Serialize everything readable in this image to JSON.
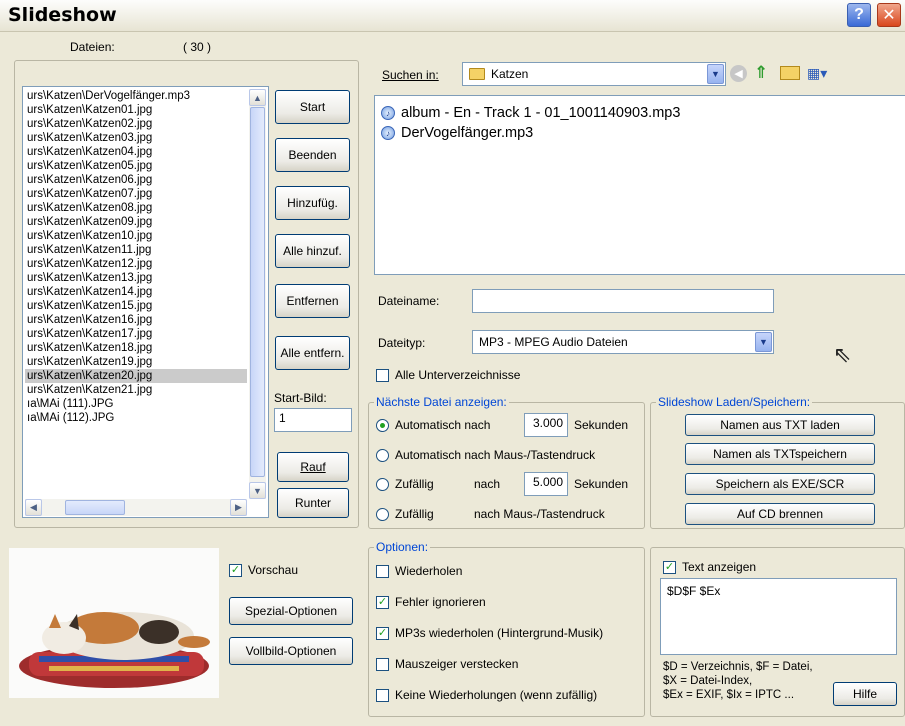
{
  "window": {
    "title": "Slideshow",
    "help_icon": "?",
    "close_icon": "✕"
  },
  "files": {
    "label": "Dateien:",
    "count": "( 30 )",
    "items": [
      "urs\\Katzen\\DerVogelfänger.mp3",
      "urs\\Katzen\\Katzen01.jpg",
      "urs\\Katzen\\Katzen02.jpg",
      "urs\\Katzen\\Katzen03.jpg",
      "urs\\Katzen\\Katzen04.jpg",
      "urs\\Katzen\\Katzen05.jpg",
      "urs\\Katzen\\Katzen06.jpg",
      "urs\\Katzen\\Katzen07.jpg",
      "urs\\Katzen\\Katzen08.jpg",
      "urs\\Katzen\\Katzen09.jpg",
      "urs\\Katzen\\Katzen10.jpg",
      "urs\\Katzen\\Katzen11.jpg",
      "urs\\Katzen\\Katzen12.jpg",
      "urs\\Katzen\\Katzen13.jpg",
      "urs\\Katzen\\Katzen14.jpg",
      "urs\\Katzen\\Katzen15.jpg",
      "urs\\Katzen\\Katzen16.jpg",
      "urs\\Katzen\\Katzen17.jpg",
      "urs\\Katzen\\Katzen18.jpg",
      "urs\\Katzen\\Katzen19.jpg",
      "urs\\Katzen\\Katzen20.jpg",
      "urs\\Katzen\\Katzen21.jpg",
      "ıa\\MAi (111).JPG",
      "ıa\\MAi (112).JPG"
    ],
    "selected_index": 20
  },
  "list_buttons": {
    "start": "Start",
    "beenden": "Beenden",
    "hinzufuegen": "Hinzufüg.",
    "alle_hinzufuegen": "Alle hinzuf.",
    "entfernen": "Entfernen",
    "alle_entfernen": "Alle entfern.",
    "start_bild_label": "Start-Bild:",
    "start_bild_value": "1",
    "rauf": "Rauf",
    "runter": "Runter"
  },
  "browser": {
    "suchen_label": "Suchen in:",
    "folder": "Katzen",
    "items": [
      "album - En - Track 1 - 01_1001140903.mp3",
      "DerVogelfänger.mp3"
    ],
    "dateiname_label": "Dateiname:",
    "dateiname_value": "",
    "dateityp_label": "Dateityp:",
    "dateityp_value": "MP3 - MPEG Audio Dateien",
    "alle_unterverzeichnisse": "Alle Unterverzeichnisse"
  },
  "naechste": {
    "legend": "Nächste Datei anzeigen:",
    "auto_nach": "Automatisch nach",
    "auto_value": "3.000",
    "sekunden": "Sekunden",
    "auto_maus": "Automatisch nach Maus-/Tastendruck",
    "zufaellig": "Zufällig",
    "nach": "nach",
    "zufall_value": "5.000",
    "sekunden2": "Sekunden",
    "zufaellig2": "Zufällig",
    "nach_maus": "nach Maus-/Tastendruck"
  },
  "laden": {
    "legend": "Slideshow Laden/Speichern:",
    "namen_laden": "Namen aus TXT laden",
    "namen_speichern": "Namen als TXTspeichern",
    "exe_scr": "Speichern als EXE/SCR",
    "cd": "Auf CD brennen"
  },
  "preview": {
    "vorschau": "Vorschau",
    "spezial": "Spezial-Optionen",
    "vollbild": "Vollbild-Optionen"
  },
  "optionen": {
    "legend": "Optionen:",
    "wiederholen": "Wiederholen",
    "fehler": "Fehler ignorieren",
    "mp3s": "MP3s wiederholen (Hintergrund-Musik)",
    "mauszeiger": "Mauszeiger verstecken",
    "keine": "Keine Wiederholungen (wenn zufällig)"
  },
  "text": {
    "anzeigen": "Text anzeigen",
    "value": "$D$F $Ex",
    "help1": "$D = Verzeichnis, $F = Datei,",
    "help2": "$X = Datei-Index,",
    "help3": "$Ex = EXIF, $Ix = IPTC ...",
    "hilfe": "Hilfe"
  }
}
